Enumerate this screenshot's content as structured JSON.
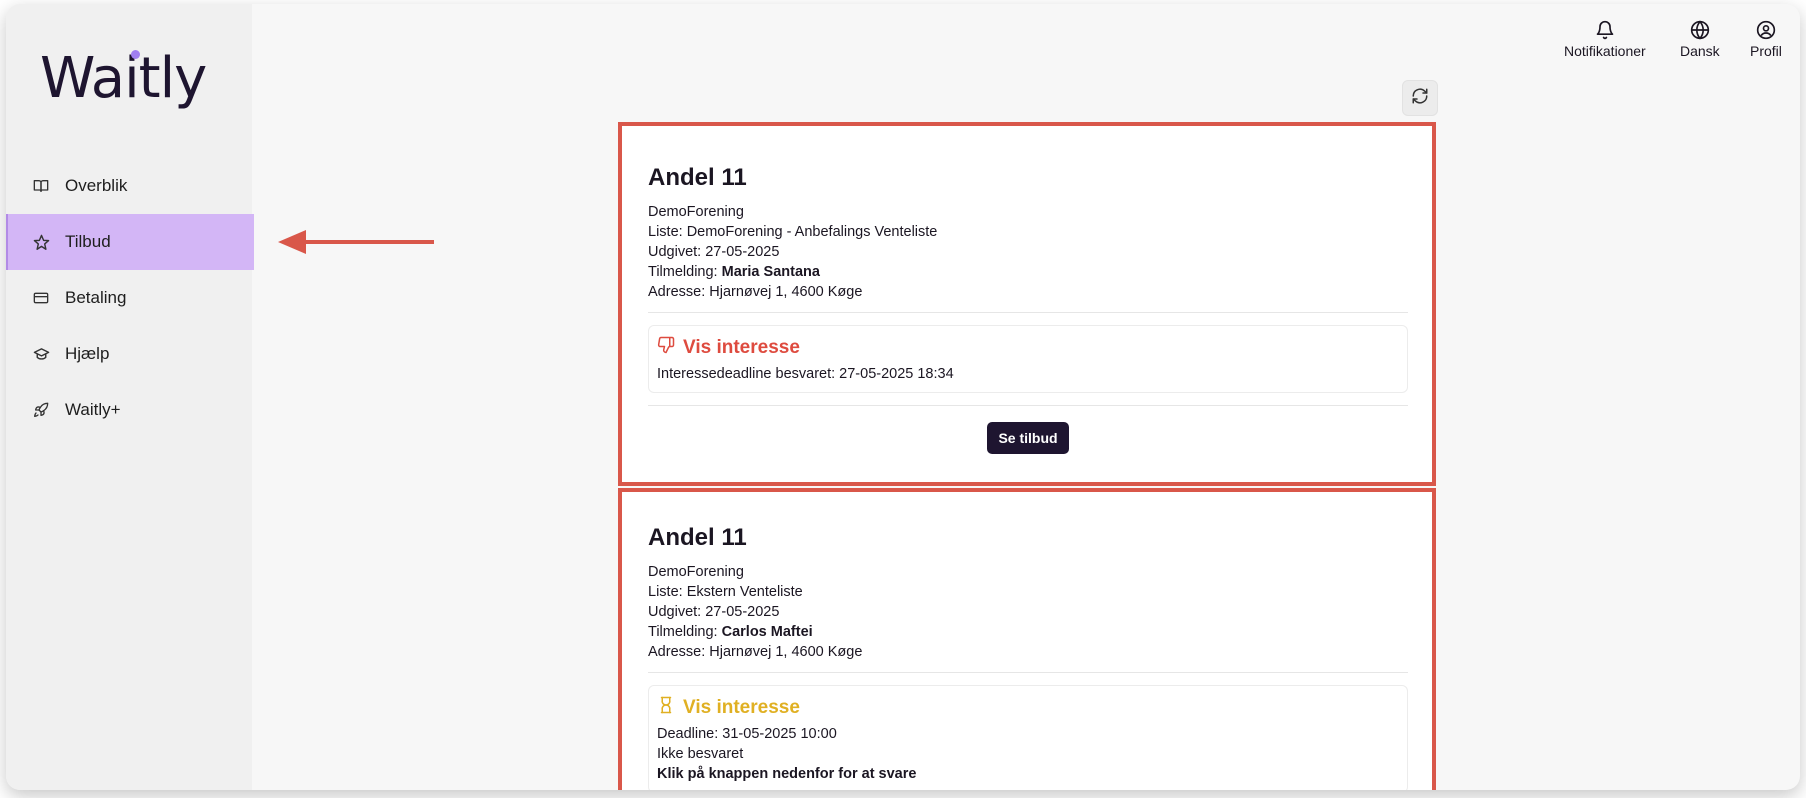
{
  "brand": {
    "logo_text": "Waitly",
    "accent": "#a07ff0"
  },
  "sidebar": {
    "items": [
      {
        "label": "Overblik",
        "icon": "book-open-icon",
        "active": false
      },
      {
        "label": "Tilbud",
        "icon": "star-icon",
        "active": true
      },
      {
        "label": "Betaling",
        "icon": "credit-card-icon",
        "active": false
      },
      {
        "label": "Hjælp",
        "icon": "graduation-cap-icon",
        "active": false
      },
      {
        "label": "Waitly+",
        "icon": "rocket-icon",
        "active": false
      }
    ]
  },
  "topbar": {
    "notifications_label": "Notifikationer",
    "language_label": "Dansk",
    "profile_label": "Profil"
  },
  "offers": [
    {
      "title": "Andel 11",
      "organization": "DemoForening",
      "list_prefix": "Liste: ",
      "list": "DemoForening - Anbefalings Venteliste",
      "published_prefix": "Udgivet: ",
      "published": "27-05-2025",
      "registration_prefix": "Tilmelding: ",
      "registration": "Maria Santana",
      "address_prefix": "Adresse: ",
      "address": "Hjarnøvej 1, 4600 Køge",
      "status_title": "Vis interesse",
      "status_icon": "thumbs-down-icon",
      "status_line": "Interessedeadline besvaret: 27-05-2025 18:34",
      "button_label": "Se tilbud"
    },
    {
      "title": "Andel 11",
      "organization": "DemoForening",
      "list_prefix": "Liste: ",
      "list": "Ekstern Venteliste",
      "published_prefix": "Udgivet: ",
      "published": "27-05-2025",
      "registration_prefix": "Tilmelding: ",
      "registration": "Carlos Maftei",
      "address_prefix": "Adresse: ",
      "address": "Hjarnøvej 1, 4600 Køge",
      "status_title": "Vis interesse",
      "status_icon": "hourglass-icon",
      "status_line_1": "Deadline: 31-05-2025 10:00",
      "status_line_2": "Ikke besvaret",
      "status_line_3": "Klik på knappen nedenfor for at svare"
    }
  ],
  "colors": {
    "highlight_border": "#d9574a",
    "active_nav": "#d3b6f6",
    "status_answered": "#de4b3f",
    "status_pending": "#e0b023",
    "button": "#1e1530"
  }
}
